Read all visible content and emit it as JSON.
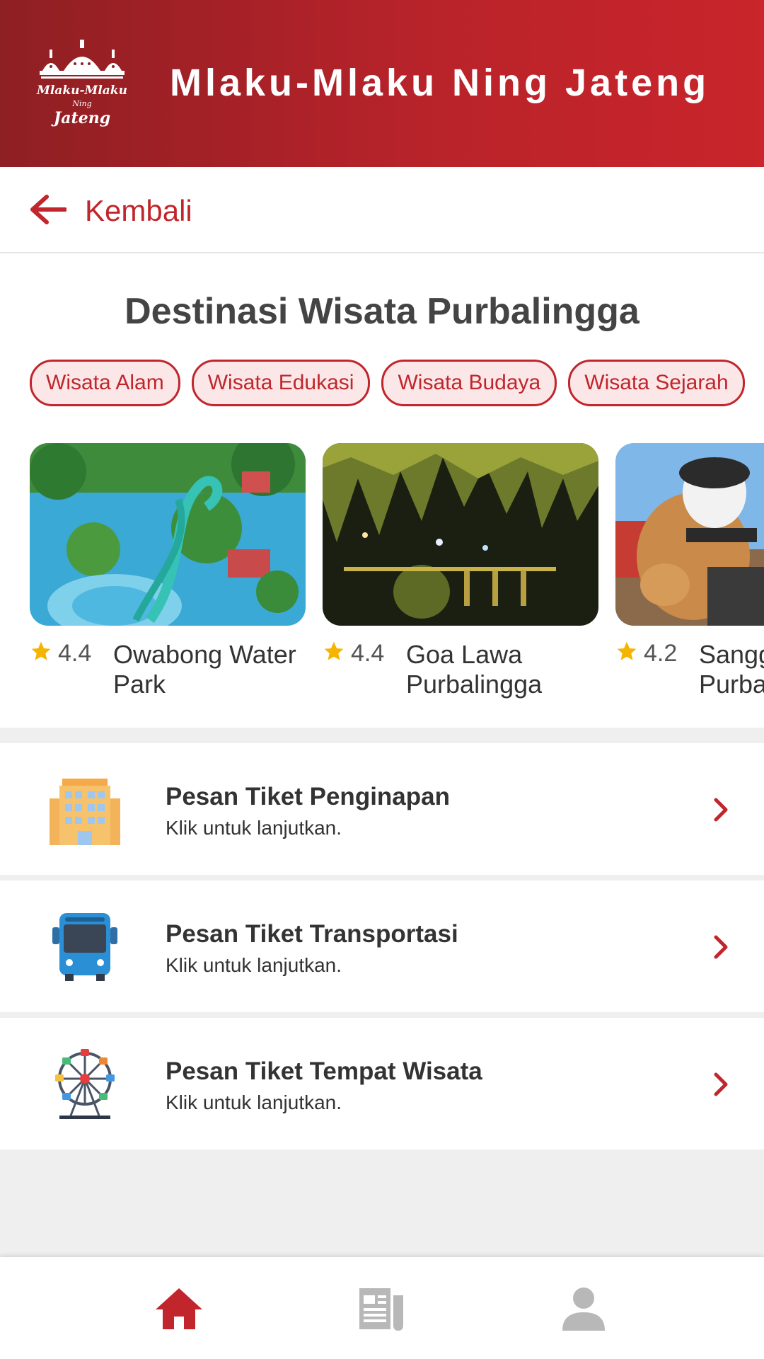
{
  "header": {
    "title": "Mlaku-Mlaku Ning Jateng",
    "logo_text": [
      "Mlaku-Mlaku",
      "Ning",
      "Jateng"
    ]
  },
  "back": {
    "label": "Kembali"
  },
  "page": {
    "title": "Destinasi Wisata Purbalingga"
  },
  "categories": [
    "Wisata Alam",
    "Wisata Edukasi",
    "Wisata Budaya",
    "Wisata Sejarah"
  ],
  "destinations": [
    {
      "rating": "4.4",
      "name": "Owabong Water Park"
    },
    {
      "rating": "4.4",
      "name": "Goa Lawa Purbalingga"
    },
    {
      "rating": "4.2",
      "name": "Sanggaluri Purbalingga"
    }
  ],
  "menu": [
    {
      "title": "Pesan Tiket Penginapan",
      "subtitle": "Klik untuk lanjutkan.",
      "icon": "hotel-icon"
    },
    {
      "title": "Pesan Tiket Transportasi",
      "subtitle": "Klik untuk lanjutkan.",
      "icon": "bus-icon"
    },
    {
      "title": "Pesan Tiket Tempat Wisata",
      "subtitle": "Klik untuk lanjutkan.",
      "icon": "ferris-wheel-icon"
    }
  ],
  "nav": [
    {
      "icon": "home-icon",
      "active": true
    },
    {
      "icon": "news-icon",
      "active": false
    },
    {
      "icon": "profile-icon",
      "active": false
    }
  ],
  "colors": {
    "primary": "#c0262c",
    "header_dark": "#8e1f23",
    "chip_bg": "#fbe7e7",
    "star": "#f5b400"
  }
}
